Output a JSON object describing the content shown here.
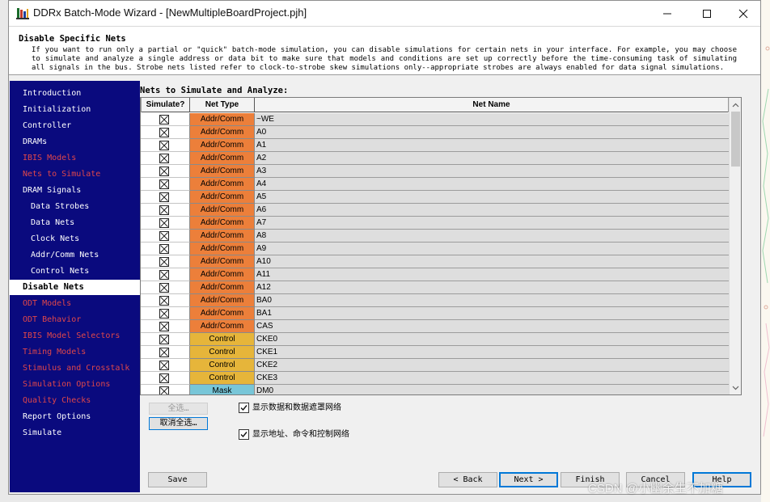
{
  "window": {
    "title": "DDRx Batch-Mode Wizard - [NewMultipleBoardProject.pjh]",
    "icon": "wizard-app-icon"
  },
  "header": {
    "title": "Disable Specific Nets",
    "body": "If you want to run only a partial or \"quick\" batch-mode simulation, you can disable simulations for certain nets in your interface.  For example, you may choose to simulate and analyze a single address or data bit to make sure that models and conditions are set up correctly before the time-consuming task of simulating all signals in the bus.  Strobe nets listed refer to clock-to-strobe skew simulations only--appropriate strobes are always enabled for data signal simulations."
  },
  "sidebar": {
    "items": [
      {
        "label": "Introduction",
        "red": false,
        "sub": false
      },
      {
        "label": "Initialization",
        "red": false,
        "sub": false
      },
      {
        "label": "Controller",
        "red": false,
        "sub": false
      },
      {
        "label": "DRAMs",
        "red": false,
        "sub": false
      },
      {
        "label": "IBIS Models",
        "red": true,
        "sub": false
      },
      {
        "label": "Nets to Simulate",
        "red": true,
        "sub": false
      },
      {
        "label": "DRAM Signals",
        "red": false,
        "sub": false
      },
      {
        "label": "Data Strobes",
        "red": false,
        "sub": true
      },
      {
        "label": "Data Nets",
        "red": false,
        "sub": true
      },
      {
        "label": "Clock Nets",
        "red": false,
        "sub": true
      },
      {
        "label": "Addr/Comm Nets",
        "red": false,
        "sub": true
      },
      {
        "label": "Control Nets",
        "red": false,
        "sub": true
      },
      {
        "label": "Disable Nets",
        "red": false,
        "sub": false,
        "active": true
      },
      {
        "label": "ODT Models",
        "red": true,
        "sub": false
      },
      {
        "label": "ODT Behavior",
        "red": true,
        "sub": false
      },
      {
        "label": "IBIS Model Selectors",
        "red": true,
        "sub": false
      },
      {
        "label": "Timing Models",
        "red": true,
        "sub": false
      },
      {
        "label": "Stimulus and Crosstalk",
        "red": true,
        "sub": false
      },
      {
        "label": "Simulation Options",
        "red": true,
        "sub": false
      },
      {
        "label": "Quality Checks",
        "red": true,
        "sub": false
      },
      {
        "label": "Report Options",
        "red": false,
        "sub": false
      },
      {
        "label": "Simulate",
        "red": false,
        "sub": false
      }
    ]
  },
  "content": {
    "title": "Nets to Simulate and Analyze:",
    "columns": {
      "simulate": "Simulate?",
      "net_type": "Net Type",
      "net_name": "Net Name"
    },
    "type_colors": {
      "Addr/Comm": "#ec7f3a",
      "Control": "#e6b53a",
      "Mask": "#78c6d8"
    },
    "rows": [
      {
        "type": "Addr/Comm",
        "name": "~WE"
      },
      {
        "type": "Addr/Comm",
        "name": "A0"
      },
      {
        "type": "Addr/Comm",
        "name": "A1"
      },
      {
        "type": "Addr/Comm",
        "name": "A2"
      },
      {
        "type": "Addr/Comm",
        "name": "A3"
      },
      {
        "type": "Addr/Comm",
        "name": "A4"
      },
      {
        "type": "Addr/Comm",
        "name": "A5"
      },
      {
        "type": "Addr/Comm",
        "name": "A6"
      },
      {
        "type": "Addr/Comm",
        "name": "A7"
      },
      {
        "type": "Addr/Comm",
        "name": "A8"
      },
      {
        "type": "Addr/Comm",
        "name": "A9"
      },
      {
        "type": "Addr/Comm",
        "name": "A10"
      },
      {
        "type": "Addr/Comm",
        "name": "A11"
      },
      {
        "type": "Addr/Comm",
        "name": "A12"
      },
      {
        "type": "Addr/Comm",
        "name": "BA0"
      },
      {
        "type": "Addr/Comm",
        "name": "BA1"
      },
      {
        "type": "Addr/Comm",
        "name": "CAS"
      },
      {
        "type": "Control",
        "name": "CKE0"
      },
      {
        "type": "Control",
        "name": "CKE1"
      },
      {
        "type": "Control",
        "name": "CKE2"
      },
      {
        "type": "Control",
        "name": "CKE3"
      },
      {
        "type": "Mask",
        "name": "DM0"
      }
    ]
  },
  "controls": {
    "select_all": "全选…",
    "deselect_all": "取消全选…",
    "show_data_nets": "显示数据和数据遮罩网络",
    "show_addr_nets": "显示地址、命令和控制网络"
  },
  "footer": {
    "save": "Save",
    "back": "< Back",
    "next": "Next >",
    "finish": "Finish",
    "cancel": "Cancel",
    "help": "Help"
  },
  "watermark": "CSDN @小幽余生不加糖"
}
